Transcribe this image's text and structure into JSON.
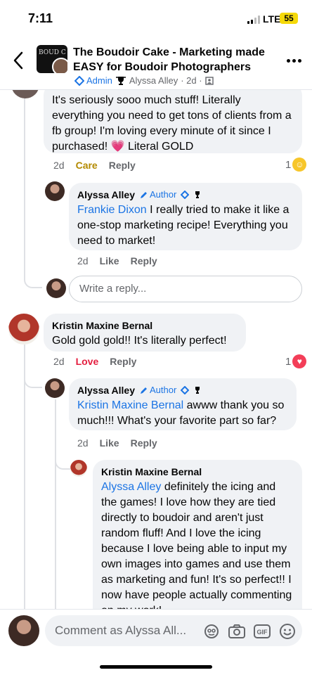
{
  "status_bar": {
    "time": "7:11",
    "network": "LTE",
    "battery": "55"
  },
  "header": {
    "title": "The Boudoir Cake - Marketing made EASY for Boudoir Photographers",
    "admin_label": "Admin",
    "poster_name": "Alyssa Alley",
    "time": "· 2d ·",
    "group_logo_text": "BOUD C"
  },
  "comments": [
    {
      "name": "Frankie Dixon",
      "text": "It's seriously sooo much stuff! Literally everything you need to get tons of clients from a fb group! I'm loving every minute of it since I purchased! 💗 Literal GOLD",
      "time": "2d",
      "reaction_label": "Care",
      "reply_label": "Reply",
      "reaction_count": "1"
    },
    {
      "name": "Alyssa Alley",
      "badge": "Author",
      "mention": "Frankie Dixon",
      "text": " I really tried to make it like a one-stop marketing recipe! Everything you need to market!",
      "time": "2d",
      "like_label": "Like",
      "reply_label": "Reply"
    },
    {
      "name": "Kristin Maxine Bernal",
      "text": "Gold gold gold!! It's literally perfect!",
      "time": "2d",
      "reaction_label": "Love",
      "reply_label": "Reply",
      "reaction_count": "1"
    },
    {
      "name": "Alyssa Alley",
      "badge": "Author",
      "mention": "Kristin Maxine Bernal",
      "text": " awww thank you so much!!! What's your favorite part so far?",
      "time": "2d",
      "like_label": "Like",
      "reply_label": "Reply"
    },
    {
      "name": "Kristin Maxine Bernal",
      "mention": "Alyssa Alley",
      "text": " definitely the icing and the games! I love how they are tied directly to boudoir and aren't just random fluff! And I love the icing because I love being able to input my own images into games and use them as marketing and fun! It's so perfect!! I now have people actually commenting on my work!"
    }
  ],
  "reply_placeholder": "Write a reply...",
  "composer": {
    "placeholder": "Comment as Alyssa All...",
    "gif_label": "GIF"
  },
  "colors": {
    "accent": "#1b74e4",
    "care": "#b38a00",
    "love": "#e41e3f",
    "bubble": "#f0f2f5"
  },
  "icons": [
    "back-arrow-icon",
    "more-icon",
    "admin-shield-icon",
    "trophy-icon",
    "pencil-icon",
    "avatar-sticker-icon",
    "camera-icon",
    "gif-icon",
    "emoji-icon"
  ]
}
